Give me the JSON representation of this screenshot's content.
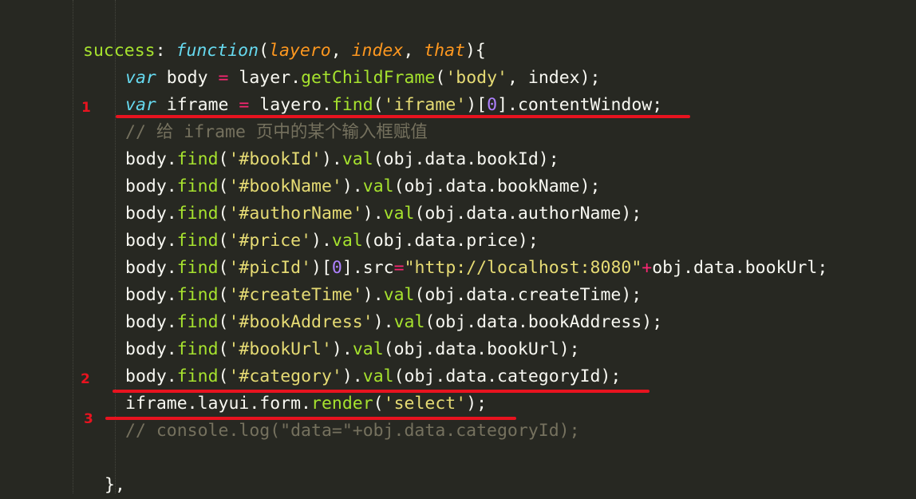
{
  "lines": [
    {
      "tokens": [
        {
          "t": "success",
          "c": "fn"
        },
        {
          "t": ": ",
          "c": "pl"
        },
        {
          "t": "function",
          "c": "kw"
        },
        {
          "t": "(",
          "c": "pl"
        },
        {
          "t": "layero",
          "c": "prm"
        },
        {
          "t": ", ",
          "c": "pl"
        },
        {
          "t": "index",
          "c": "prm"
        },
        {
          "t": ", ",
          "c": "pl"
        },
        {
          "t": "that",
          "c": "prm"
        },
        {
          "t": "){",
          "c": "pl"
        }
      ]
    },
    {
      "tokens": [
        {
          "t": "var",
          "c": "kw"
        },
        {
          "t": " body ",
          "c": "pl"
        },
        {
          "t": "=",
          "c": "op"
        },
        {
          "t": " layer.",
          "c": "pl"
        },
        {
          "t": "getChildFrame",
          "c": "fn"
        },
        {
          "t": "(",
          "c": "pl"
        },
        {
          "t": "'body'",
          "c": "str"
        },
        {
          "t": ", index);",
          "c": "pl"
        }
      ]
    },
    {
      "tokens": [
        {
          "t": "var",
          "c": "kw"
        },
        {
          "t": " iframe ",
          "c": "pl"
        },
        {
          "t": "=",
          "c": "op"
        },
        {
          "t": " layero.",
          "c": "pl"
        },
        {
          "t": "find",
          "c": "fn"
        },
        {
          "t": "(",
          "c": "pl"
        },
        {
          "t": "'iframe'",
          "c": "str"
        },
        {
          "t": ")[",
          "c": "pl"
        },
        {
          "t": "0",
          "c": "num"
        },
        {
          "t": "].contentWindow;",
          "c": "pl"
        }
      ]
    },
    {
      "tokens": [
        {
          "t": "// 给 iframe 页中的某个输入框赋值",
          "c": "cm"
        }
      ]
    },
    {
      "tokens": [
        {
          "t": "body.",
          "c": "pl"
        },
        {
          "t": "find",
          "c": "fn"
        },
        {
          "t": "(",
          "c": "pl"
        },
        {
          "t": "'#bookId'",
          "c": "str"
        },
        {
          "t": ").",
          "c": "pl"
        },
        {
          "t": "val",
          "c": "fn"
        },
        {
          "t": "(obj.data.bookId);",
          "c": "pl"
        }
      ]
    },
    {
      "tokens": [
        {
          "t": "body.",
          "c": "pl"
        },
        {
          "t": "find",
          "c": "fn"
        },
        {
          "t": "(",
          "c": "pl"
        },
        {
          "t": "'#bookName'",
          "c": "str"
        },
        {
          "t": ").",
          "c": "pl"
        },
        {
          "t": "val",
          "c": "fn"
        },
        {
          "t": "(obj.data.bookName);",
          "c": "pl"
        }
      ]
    },
    {
      "tokens": [
        {
          "t": "body.",
          "c": "pl"
        },
        {
          "t": "find",
          "c": "fn"
        },
        {
          "t": "(",
          "c": "pl"
        },
        {
          "t": "'#authorName'",
          "c": "str"
        },
        {
          "t": ").",
          "c": "pl"
        },
        {
          "t": "val",
          "c": "fn"
        },
        {
          "t": "(obj.data.authorName);",
          "c": "pl"
        }
      ]
    },
    {
      "tokens": [
        {
          "t": "body.",
          "c": "pl"
        },
        {
          "t": "find",
          "c": "fn"
        },
        {
          "t": "(",
          "c": "pl"
        },
        {
          "t": "'#price'",
          "c": "str"
        },
        {
          "t": ").",
          "c": "pl"
        },
        {
          "t": "val",
          "c": "fn"
        },
        {
          "t": "(obj.data.price);",
          "c": "pl"
        }
      ]
    },
    {
      "tokens": [
        {
          "t": "body.",
          "c": "pl"
        },
        {
          "t": "find",
          "c": "fn"
        },
        {
          "t": "(",
          "c": "pl"
        },
        {
          "t": "'#picId'",
          "c": "str"
        },
        {
          "t": ")[",
          "c": "pl"
        },
        {
          "t": "0",
          "c": "num"
        },
        {
          "t": "].src",
          "c": "pl"
        },
        {
          "t": "=",
          "c": "op"
        },
        {
          "t": "\"http://localhost:8080\"",
          "c": "str"
        },
        {
          "t": "+",
          "c": "op"
        },
        {
          "t": "obj.data.bookUrl;",
          "c": "pl"
        }
      ]
    },
    {
      "tokens": [
        {
          "t": "body.",
          "c": "pl"
        },
        {
          "t": "find",
          "c": "fn"
        },
        {
          "t": "(",
          "c": "pl"
        },
        {
          "t": "'#createTime'",
          "c": "str"
        },
        {
          "t": ").",
          "c": "pl"
        },
        {
          "t": "val",
          "c": "fn"
        },
        {
          "t": "(obj.data.createTime);",
          "c": "pl"
        }
      ]
    },
    {
      "tokens": [
        {
          "t": "body.",
          "c": "pl"
        },
        {
          "t": "find",
          "c": "fn"
        },
        {
          "t": "(",
          "c": "pl"
        },
        {
          "t": "'#bookAddress'",
          "c": "str"
        },
        {
          "t": ").",
          "c": "pl"
        },
        {
          "t": "val",
          "c": "fn"
        },
        {
          "t": "(obj.data.bookAddress);",
          "c": "pl"
        }
      ]
    },
    {
      "tokens": [
        {
          "t": "body.",
          "c": "pl"
        },
        {
          "t": "find",
          "c": "fn"
        },
        {
          "t": "(",
          "c": "pl"
        },
        {
          "t": "'#bookUrl'",
          "c": "str"
        },
        {
          "t": ").",
          "c": "pl"
        },
        {
          "t": "val",
          "c": "fn"
        },
        {
          "t": "(obj.data.bookUrl);",
          "c": "pl"
        }
      ]
    },
    {
      "tokens": [
        {
          "t": "body.",
          "c": "pl"
        },
        {
          "t": "find",
          "c": "fn"
        },
        {
          "t": "(",
          "c": "pl"
        },
        {
          "t": "'#category'",
          "c": "str"
        },
        {
          "t": ").",
          "c": "pl"
        },
        {
          "t": "val",
          "c": "fn"
        },
        {
          "t": "(obj.data.categoryId);",
          "c": "pl"
        }
      ]
    },
    {
      "tokens": [
        {
          "t": "iframe.layui.form.",
          "c": "pl"
        },
        {
          "t": "render",
          "c": "fn"
        },
        {
          "t": "(",
          "c": "pl"
        },
        {
          "t": "'select'",
          "c": "str"
        },
        {
          "t": ");",
          "c": "pl"
        }
      ]
    },
    {
      "tokens": [
        {
          "t": "// console.log(\"data=\"+obj.data.categoryId);",
          "c": "cm"
        }
      ]
    },
    {
      "tokens": []
    },
    {
      "tokens": [
        {
          "t": "},",
          "c": "pl"
        }
      ]
    }
  ],
  "annotations": [
    {
      "label": "1",
      "line": 2
    },
    {
      "label": "2",
      "line": 12
    },
    {
      "label": "3",
      "line": 13
    }
  ],
  "colors": {
    "background": "#272822",
    "plain": "#f8f8f2",
    "keyword": "#66d9ef",
    "function": "#a6e22e",
    "parameter": "#fd971f",
    "string": "#e6db74",
    "number": "#ae81ff",
    "operator": "#f92672",
    "comment": "#75715e",
    "annotation": "#e8131f"
  }
}
